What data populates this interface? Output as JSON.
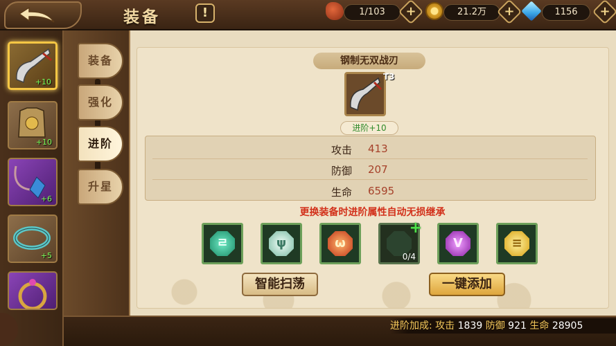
{
  "header": {
    "title": "装备",
    "info_label": "!",
    "resources": [
      {
        "icon": "meat-icon",
        "value": "1/103"
      },
      {
        "icon": "coin-icon",
        "value": "21.2万"
      },
      {
        "icon": "diamond-icon",
        "value": "1156"
      }
    ]
  },
  "equipment_list": [
    {
      "name": "sword",
      "icon": "sword-icon",
      "level": "+10",
      "selected": true,
      "color": "#d4b04a"
    },
    {
      "name": "armor",
      "icon": "armor-icon",
      "level": "+10",
      "selected": false,
      "color": "#9a7f55"
    },
    {
      "name": "amulet",
      "icon": "amulet-icon",
      "level": "+6",
      "selected": false,
      "color": "#7c3ea1"
    },
    {
      "name": "bracelet",
      "icon": "bracelet-icon",
      "level": "+5",
      "selected": false,
      "color": "#9a7f55"
    },
    {
      "name": "ring",
      "icon": "ring-icon",
      "level": "",
      "selected": false,
      "color": "#7c3ea1"
    }
  ],
  "tabs": [
    {
      "label": "装备",
      "active": false
    },
    {
      "label": "强化",
      "active": false
    },
    {
      "label": "进阶",
      "active": true
    },
    {
      "label": "升星",
      "active": false
    }
  ],
  "item": {
    "name": "钢制无双战刃",
    "tier": "T3",
    "stage": "进阶+10"
  },
  "stats": [
    {
      "label": "攻击",
      "value": "413"
    },
    {
      "label": "防御",
      "value": "207"
    },
    {
      "label": "生命",
      "value": "6595"
    }
  ],
  "notice": "更换装备时进阶属性自动无损继承",
  "gems": [
    {
      "icon": "jade-gem-icon",
      "glyph": "ㄹ",
      "color": "#2fc49c",
      "empty": false
    },
    {
      "icon": "claw-gem-icon",
      "glyph": "ψ",
      "color": "#c6e8da",
      "empty": false
    },
    {
      "icon": "fire-gem-icon",
      "glyph": "ω",
      "color": "#e04a1c",
      "empty": false
    },
    {
      "icon": "empty-gem-slot-icon",
      "glyph": "",
      "color": "#3a5a3a",
      "empty": true,
      "count": "0/4"
    },
    {
      "icon": "violet-gem-icon",
      "glyph": "V",
      "color": "#b83fcf",
      "empty": false
    },
    {
      "icon": "gold-gem-icon",
      "glyph": "≡",
      "color": "#f2c32b",
      "empty": false
    }
  ],
  "buttons": {
    "sweep": "智能扫荡",
    "add_all": "一键添加"
  },
  "bonus": {
    "label": "进阶加成:",
    "atk_label": "攻击",
    "atk_value": "1839",
    "def_label": "防御",
    "def_value": "921",
    "hp_label": "生命",
    "hp_value": "28905"
  }
}
